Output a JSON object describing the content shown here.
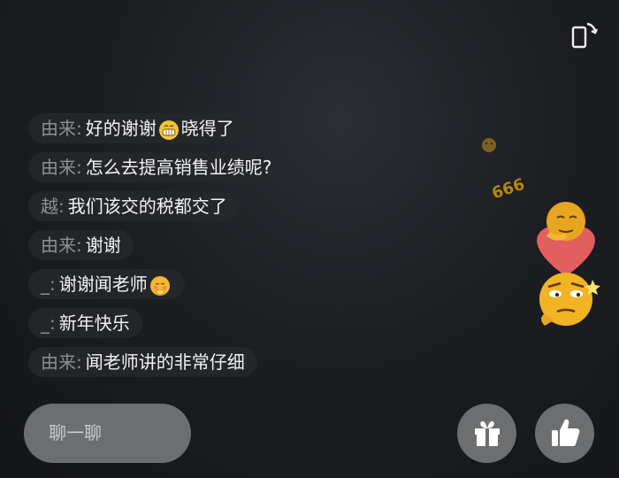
{
  "messages": [
    {
      "user": "由来",
      "colon": ":",
      "text": "好的谢谢",
      "emoji": "grin-emoji",
      "text_after": "晓得了"
    },
    {
      "user": "由来",
      "colon": ":",
      "text": "怎么去提高销售业绩呢?"
    },
    {
      "user": "越",
      "colon": ":",
      "text": "我们该交的税都交了"
    },
    {
      "user": "由来",
      "colon": ":",
      "text": "谢谢"
    },
    {
      "user": "_",
      "colon": ":",
      "text": "谢谢闻老师",
      "emoji": "shy-emoji"
    },
    {
      "user": "_",
      "colon": ":",
      "text": "新年快乐"
    },
    {
      "user": "由来",
      "colon": ":",
      "text": "闻老师讲的非常仔细"
    }
  ],
  "input": {
    "placeholder": "聊一聊"
  },
  "floating": {
    "text": "666"
  },
  "icons": {
    "rotate": "rotate-screen-icon",
    "gift": "gift-icon",
    "like": "thumbs-up-icon"
  },
  "colors": {
    "username": "#8c8f95",
    "message": "#f2f2f2",
    "button_bg": "#6c6e70"
  }
}
